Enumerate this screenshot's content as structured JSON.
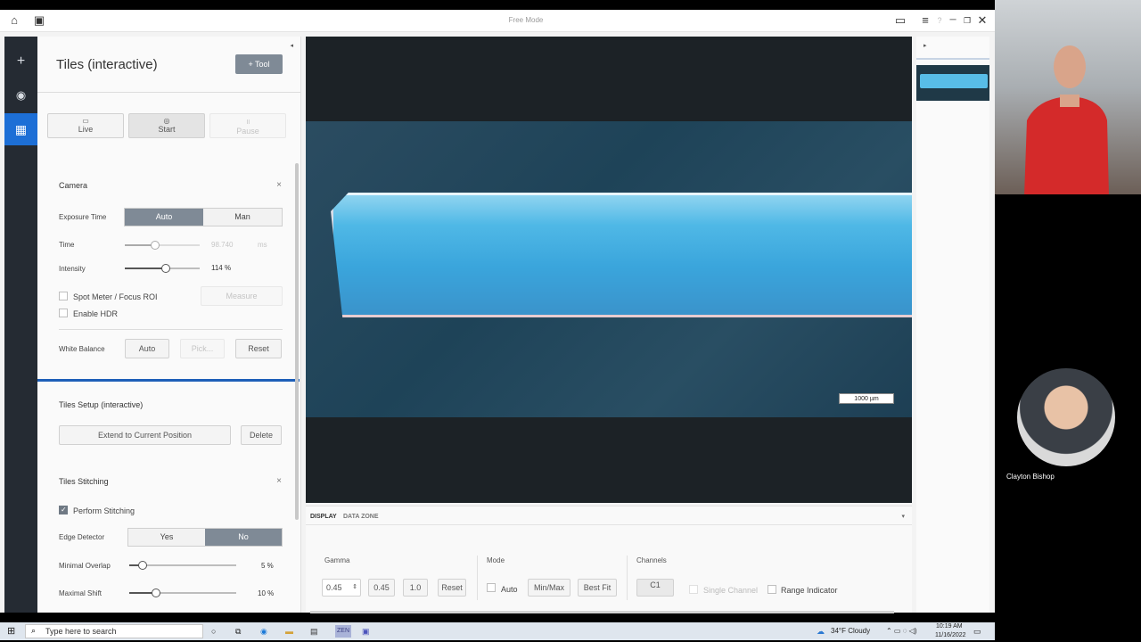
{
  "window": {
    "title": "Free Mode"
  },
  "rail": {
    "add_icon": "plus-icon",
    "camera_icon": "camera-icon",
    "tiles_icon": "grid-icon"
  },
  "panel": {
    "title": "Tiles (interactive)",
    "tool_button": "Tool",
    "acquire": {
      "live": "Live",
      "start": "Start",
      "pause": "Pause"
    }
  },
  "camera": {
    "title": "Camera",
    "exposure_label": "Exposure Time",
    "exposure_options": [
      "Auto",
      "Man"
    ],
    "exposure_selected": "Auto",
    "time_label": "Time",
    "time_value": "98.740",
    "time_unit": "ms",
    "intensity_label": "Intensity",
    "intensity_value": "114 %",
    "spot_meter_label": "Spot Meter / Focus ROI",
    "measure_button": "Measure",
    "hdr_label": "Enable HDR",
    "white_balance_label": "White Balance",
    "wb_auto": "Auto",
    "wb_pick": "Pick...",
    "wb_reset": "Reset"
  },
  "tiles_setup": {
    "title": "Tiles Setup (interactive)",
    "extend_button": "Extend to Current Position",
    "delete_button": "Delete"
  },
  "stitching": {
    "title": "Tiles Stitching",
    "perform_label": "Perform Stitching",
    "perform_checked": true,
    "edge_label": "Edge Detector",
    "edge_options": [
      "Yes",
      "No"
    ],
    "edge_selected": "No",
    "overlap_label": "Minimal Overlap",
    "overlap_value": "5 %",
    "shift_label": "Maximal Shift",
    "shift_value": "10 %"
  },
  "viewer": {
    "scale_label": "1000 µm"
  },
  "display": {
    "tabs": [
      "DISPLAY",
      "DATA ZONE"
    ],
    "gamma_label": "Gamma",
    "gamma_value": "0.45",
    "gamma_preset1": "0.45",
    "gamma_preset2": "1.0",
    "gamma_reset": "Reset",
    "mode_label": "Mode",
    "mode_auto": "Auto",
    "mode_minmax": "Min/Max",
    "mode_bestfit": "Best Fit",
    "channels_label": "Channels",
    "channel_c1": "C1",
    "single_channel": "Single Channel",
    "range_indicator": "Range Indicator"
  },
  "taskbar": {
    "search_placeholder": "Type here to search",
    "weather": "34°F  Cloudy",
    "time": "10:19 AM",
    "date": "11/16/2022"
  },
  "call": {
    "participant_name": "Clayton Bishop"
  }
}
